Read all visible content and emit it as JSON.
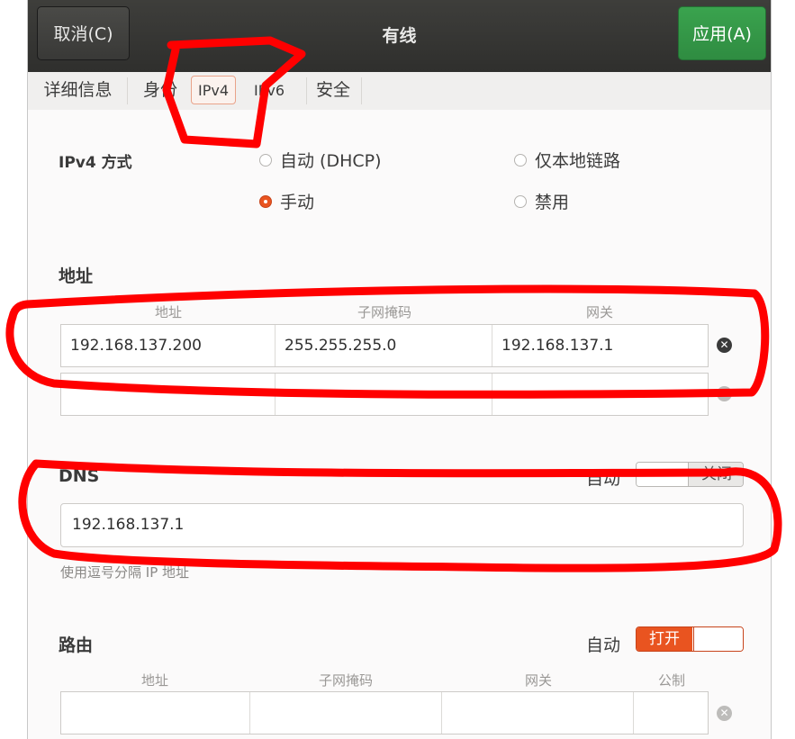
{
  "header": {
    "cancel_label": "取消(C)",
    "title": "有线",
    "apply_label": "应用(A)"
  },
  "tabs": [
    {
      "label": "详细信息"
    },
    {
      "label": "身份"
    },
    {
      "label": "IPv4"
    },
    {
      "label": "IPv6"
    },
    {
      "label": "安全"
    }
  ],
  "ipv4_method": {
    "label": "IPv4 方式",
    "options": [
      "自动 (DHCP)",
      "仅本地链路",
      "手动",
      "禁用"
    ],
    "selected": "手动"
  },
  "address": {
    "section_label": "地址",
    "columns": [
      "地址",
      "子网掩码",
      "网关"
    ],
    "rows": [
      {
        "address": "192.168.137.200",
        "netmask": "255.255.255.0",
        "gateway": "192.168.137.1"
      },
      {
        "address": "",
        "netmask": "",
        "gateway": ""
      }
    ]
  },
  "dns": {
    "label": "DNS",
    "auto_label": "自动",
    "toggle_state": "关闭",
    "value": "192.168.137.1",
    "hint": "使用逗号分隔 IP 地址"
  },
  "routes": {
    "label": "路由",
    "auto_label": "自动",
    "toggle_state": "打开",
    "columns": [
      "地址",
      "子网掩码",
      "网关",
      "公制"
    ]
  },
  "colors": {
    "accent": "#e95420",
    "apply": "#3aa34e",
    "annotation": "#ff0000"
  }
}
